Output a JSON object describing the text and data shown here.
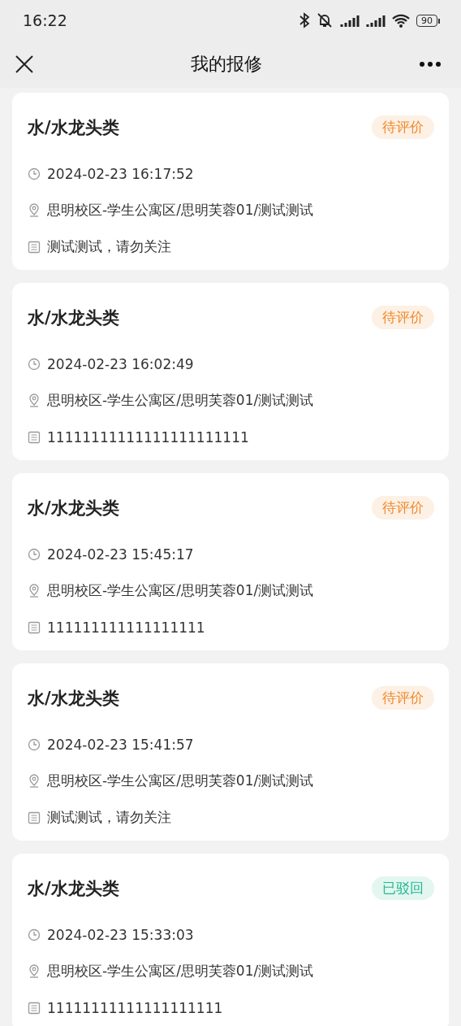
{
  "status_bar": {
    "time": "16:22",
    "battery": "90"
  },
  "header": {
    "title": "我的报修"
  },
  "orders": [
    {
      "category": "水/水龙头类",
      "status": {
        "label": "待评价",
        "kind": "pending"
      },
      "time": "2024-02-23 16:17:52",
      "location": "思明校区-学生公寓区/思明芙蓉01/测试测试",
      "note": "测试测试，请勿关注"
    },
    {
      "category": "水/水龙头类",
      "status": {
        "label": "待评价",
        "kind": "pending"
      },
      "time": "2024-02-23 16:02:49",
      "location": "思明校区-学生公寓区/思明芙蓉01/测试测试",
      "note": "11111111111111111111111"
    },
    {
      "category": "水/水龙头类",
      "status": {
        "label": "待评价",
        "kind": "pending"
      },
      "time": "2024-02-23 15:45:17",
      "location": "思明校区-学生公寓区/思明芙蓉01/测试测试",
      "note": "111111111111111111"
    },
    {
      "category": "水/水龙头类",
      "status": {
        "label": "待评价",
        "kind": "pending"
      },
      "time": "2024-02-23 15:41:57",
      "location": "思明校区-学生公寓区/思明芙蓉01/测试测试",
      "note": "测试测试，请勿关注"
    },
    {
      "category": "水/水龙头类",
      "status": {
        "label": "已驳回",
        "kind": "rejected"
      },
      "time": "2024-02-23 15:33:03",
      "location": "思明校区-学生公寓区/思明芙蓉01/测试测试",
      "note": "11111111111111111111"
    }
  ]
}
